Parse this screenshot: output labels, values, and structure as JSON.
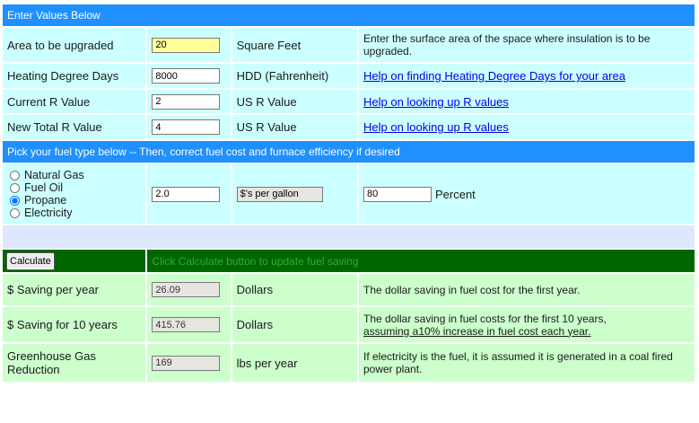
{
  "header": {
    "title": "Enter Values Below"
  },
  "inputs": [
    {
      "label": "Area to be upgraded",
      "value": "20",
      "unit": "Square Feet",
      "desc": "Enter the surface area of the space where insulation is to be upgraded."
    },
    {
      "label": "Heating Degree Days",
      "value": "8000",
      "unit": "HDD (Fahrenheit)",
      "link": "Help on finding Heating Degree Days for your area"
    },
    {
      "label": "Current R Value",
      "value": "2",
      "unit": "US R Value",
      "link": "Help on looking up R values"
    },
    {
      "label": "New Total R Value",
      "value": "4",
      "unit": "US R Value",
      "link": "Help on looking up R values"
    }
  ],
  "fuel": {
    "header": "Pick your fuel type below -- Then, correct fuel cost and furnace efficiency if desired",
    "options": [
      "Natural Gas",
      "Fuel Oil",
      "Propane",
      "Electricity"
    ],
    "selected": "Propane",
    "cost_value": "2.0",
    "cost_unit": "$'s per gallon",
    "efficiency_value": "80",
    "efficiency_unit": "Percent"
  },
  "calc": {
    "button_label": "Calculate",
    "hint": "Click Calculate button to update fuel saving"
  },
  "results": [
    {
      "label": "$ Saving per year",
      "value": "26.09",
      "unit": "Dollars",
      "desc": "The dollar saving in fuel cost for the first year."
    },
    {
      "label": "$ Saving for 10 years",
      "value": "415.76",
      "unit": "Dollars",
      "desc_line1": "The dollar saving in fuel costs for the first 10 years,",
      "desc_line2": "assuming a10% increase in fuel cost each year."
    },
    {
      "label": "Greenhouse Gas Reduction",
      "value": "169",
      "unit": "lbs per year",
      "desc": "If electricity is the fuel, it is assumed it is generated in a coal fired power plant."
    }
  ],
  "colors": {
    "header": "#1E90FF",
    "input_row": "#CCFFFF",
    "result_row": "#CCFFCC",
    "calc_row": "#006600",
    "spacer_row": "#DDE8FF"
  }
}
